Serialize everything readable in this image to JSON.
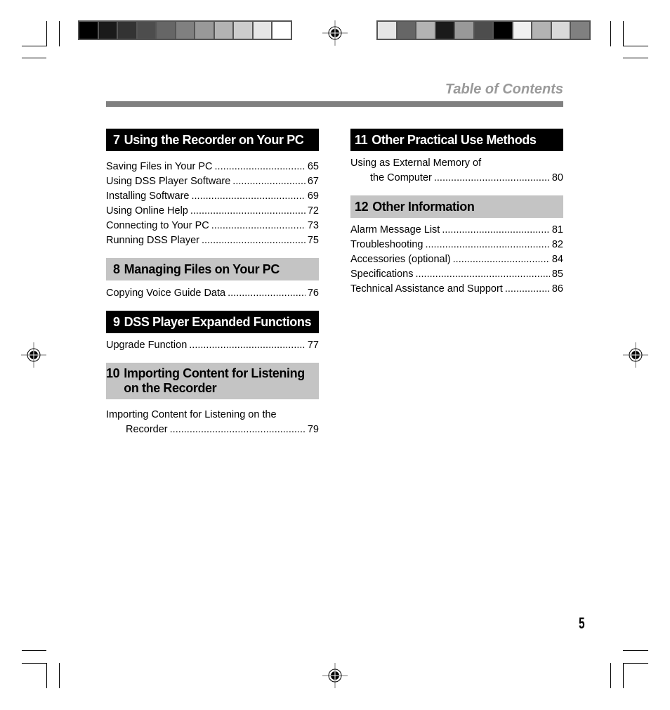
{
  "header": {
    "title": "Table of Contents",
    "rule_color": "#808080",
    "title_color": "#9a9a9a"
  },
  "print_marks": {
    "swatches_left": [
      "#000000",
      "#1a1a1a",
      "#333333",
      "#4d4d4d",
      "#666666",
      "#808080",
      "#999999",
      "#b3b3b3",
      "#cccccc",
      "#e6e6e6",
      "#ffffff"
    ],
    "swatches_right": [
      "#e6e6e6",
      "#666666",
      "#b3b3b3",
      "#1a1a1a",
      "#999999",
      "#4d4d4d",
      "#000000",
      "#f0f0f0",
      "#b3b3b3",
      "#d9d9d9",
      "#808080"
    ]
  },
  "sections": {
    "s7": {
      "number": "7",
      "title": "Using the Recorder on Your PC",
      "style": "dark",
      "entries": [
        {
          "label": "Saving Files in Your PC",
          "page": "65"
        },
        {
          "label": "Using DSS Player Software",
          "page": "67"
        },
        {
          "label": "Installing Software",
          "page": "69"
        },
        {
          "label": "Using Online Help",
          "page": "72"
        },
        {
          "label": "Connecting to Your PC",
          "page": "73"
        },
        {
          "label": "Running DSS Player",
          "page": "75"
        }
      ]
    },
    "s8": {
      "number": "8",
      "title": "Managing Files on Your PC",
      "style": "light",
      "entries": [
        {
          "label": "Copying Voice Guide Data",
          "page": "76"
        }
      ]
    },
    "s9": {
      "number": "9",
      "title": "DSS Player Expanded Functions",
      "style": "dark",
      "entries": [
        {
          "label": "Upgrade Function",
          "page": "77"
        }
      ]
    },
    "s10": {
      "number": "10",
      "title_line1": "Importing Content for Listening",
      "title_line2": "on the Recorder",
      "style": "light",
      "entries": [
        {
          "label_line1": "Importing Content for Listening on the",
          "label": "Recorder",
          "page": "79"
        }
      ]
    },
    "s11": {
      "number": "11",
      "title": "Other Practical Use Methods",
      "style": "dark",
      "entries": [
        {
          "label_line1": "Using as External Memory of",
          "label": "the Computer",
          "page": "80"
        }
      ]
    },
    "s12": {
      "number": "12",
      "title": "Other Information",
      "style": "light",
      "entries": [
        {
          "label": "Alarm Message List",
          "page": "81"
        },
        {
          "label": "Troubleshooting",
          "page": "82"
        },
        {
          "label": "Accessories (optional)",
          "page": "84"
        },
        {
          "label": "Specifications",
          "page": "85"
        },
        {
          "label": "Technical Assistance and Support",
          "page": "86"
        }
      ]
    }
  },
  "footer": {
    "page_number": "5"
  }
}
